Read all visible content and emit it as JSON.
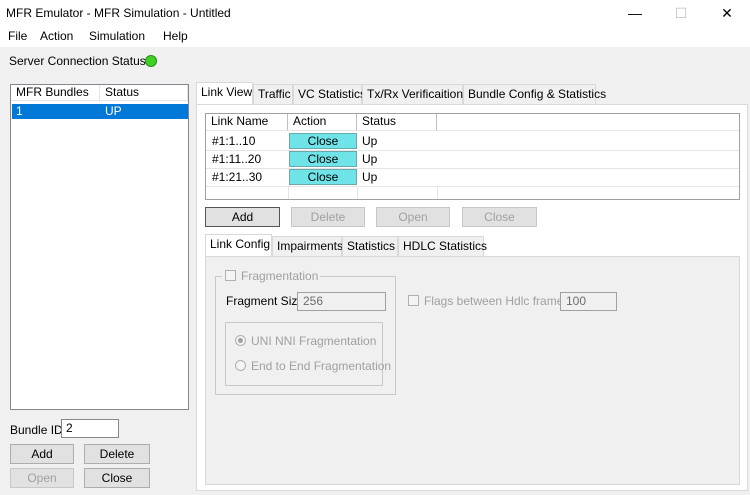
{
  "window": {
    "title": "MFR Emulator - MFR Simulation - Untitled",
    "minimize_glyph": "—",
    "maximize_glyph": "☐",
    "close_glyph": "✕"
  },
  "menu": [
    "File",
    "Action",
    "Simulation",
    "Help"
  ],
  "status": {
    "label": "Server Connection Status",
    "indicator_color": "#3cd420"
  },
  "bundles": {
    "columns": [
      "MFR Bundles",
      "Status"
    ],
    "rows": [
      {
        "bundle": "1",
        "status": "UP"
      }
    ],
    "selection_color": "#0078d7",
    "bundle_id_label": "Bundle ID",
    "bundle_id_value": "2",
    "buttons": {
      "add": "Add",
      "delete": "Delete",
      "open": "Open",
      "close": "Close"
    }
  },
  "tabs": [
    "Link View",
    "Traffic",
    "VC Statistics",
    "Tx/Rx Verificaition",
    "Bundle Config & Statistics"
  ],
  "link_table": {
    "columns": [
      "Link Name",
      "Action",
      "Status"
    ],
    "rows": [
      {
        "name": "#1:1..10",
        "action": "Close",
        "status": "Up"
      },
      {
        "name": "#1:11..20",
        "action": "Close",
        "status": "Up"
      },
      {
        "name": "#1:21..30",
        "action": "Close",
        "status": "Up"
      }
    ],
    "action_color": "#6ee3e8"
  },
  "link_buttons": {
    "add": "Add",
    "delete": "Delete",
    "open": "Open",
    "close": "Close"
  },
  "sub_tabs": [
    "Link Config",
    "Impairments",
    "Statistics",
    "HDLC Statistics"
  ],
  "link_config": {
    "fragmentation_label": "Fragmentation",
    "fragment_size_label": "Fragment Size",
    "fragment_size_value": "256",
    "uni_nni_label": "UNI NNI Fragmentation",
    "end_to_end_label": "End to End Fragmentation",
    "flags_label": "Flags between Hdlc frames",
    "flags_value": "100"
  }
}
